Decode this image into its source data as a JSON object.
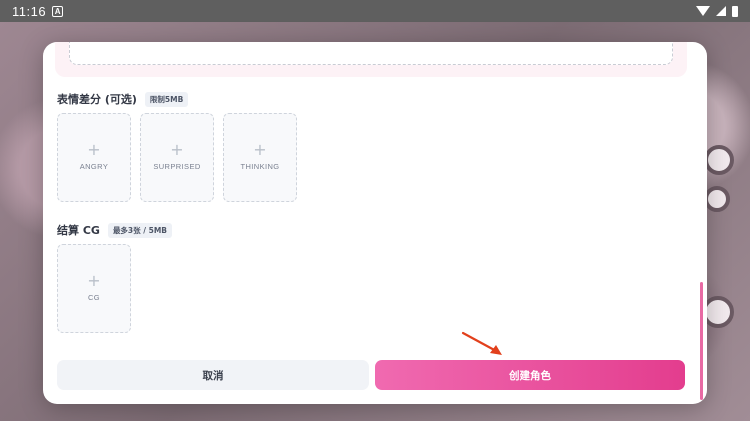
{
  "status_bar": {
    "time": "11:16",
    "badge": "A"
  },
  "expressions": {
    "title": "表情差分 (可选)",
    "tag": "限制5MB",
    "slots": [
      {
        "plus": "+",
        "label": "ANGRY"
      },
      {
        "plus": "+",
        "label": "SURPRISED"
      },
      {
        "plus": "+",
        "label": "THINKING"
      }
    ]
  },
  "ending_cg": {
    "title": "结算 CG",
    "tag": "最多3张 / 5MB",
    "slots": [
      {
        "plus": "+",
        "label": "CG"
      }
    ]
  },
  "actions": {
    "cancel_label": "取消",
    "create_label": "创建角色"
  },
  "colors": {
    "accent": "#e33d8e",
    "accent_light": "#f06ab0",
    "annotation_arrow": "#e2401c"
  }
}
